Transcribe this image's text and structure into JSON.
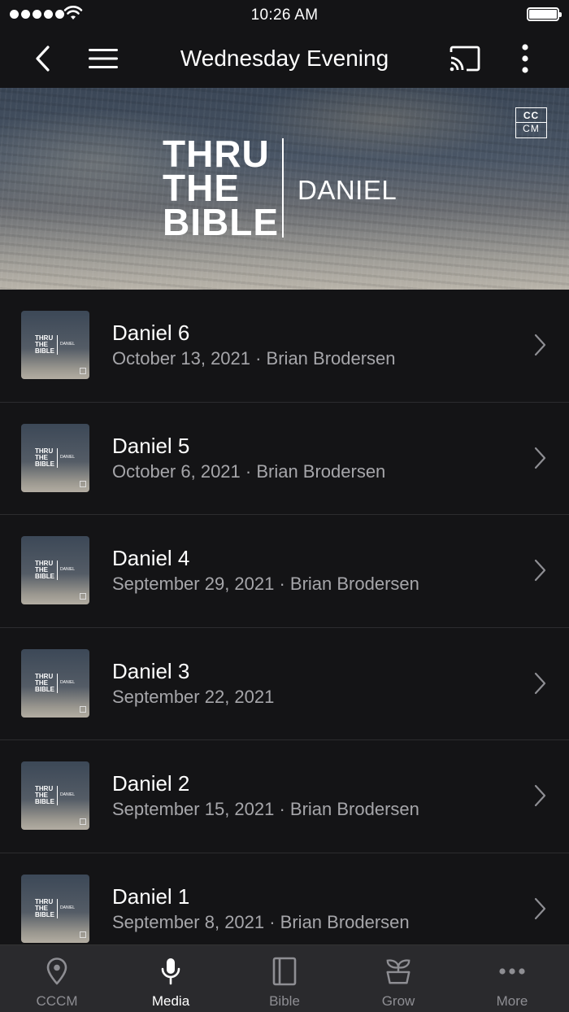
{
  "status_bar": {
    "time": "10:26 AM"
  },
  "nav": {
    "title": "Wednesday Evening"
  },
  "banner": {
    "title_lines": [
      "THRU",
      "THE",
      "BIBLE"
    ],
    "subtitle": "DANIEL",
    "logo_top": "CC",
    "logo_bottom": "CM"
  },
  "thumbnail": {
    "title_lines": [
      "THRU",
      "THE",
      "BIBLE"
    ],
    "subtitle": "DANIEL"
  },
  "items": [
    {
      "title": "Daniel 6",
      "subtitle": "October 13, 2021 · Brian Brodersen"
    },
    {
      "title": "Daniel 5",
      "subtitle": "October 6, 2021 · Brian Brodersen"
    },
    {
      "title": "Daniel 4",
      "subtitle": "September 29, 2021 · Brian Brodersen"
    },
    {
      "title": "Daniel 3",
      "subtitle": "September 22, 2021"
    },
    {
      "title": "Daniel 2",
      "subtitle": "September 15, 2021 · Brian Brodersen"
    },
    {
      "title": "Daniel 1",
      "subtitle": "September 8, 2021 · Brian Brodersen"
    }
  ],
  "tabs": [
    {
      "label": "CCCM",
      "icon": "location-pin-icon",
      "active": false
    },
    {
      "label": "Media",
      "icon": "microphone-icon",
      "active": true
    },
    {
      "label": "Bible",
      "icon": "book-icon",
      "active": false
    },
    {
      "label": "Grow",
      "icon": "sprout-icon",
      "active": false
    },
    {
      "label": "More",
      "icon": "more-dots-icon",
      "active": false
    }
  ]
}
